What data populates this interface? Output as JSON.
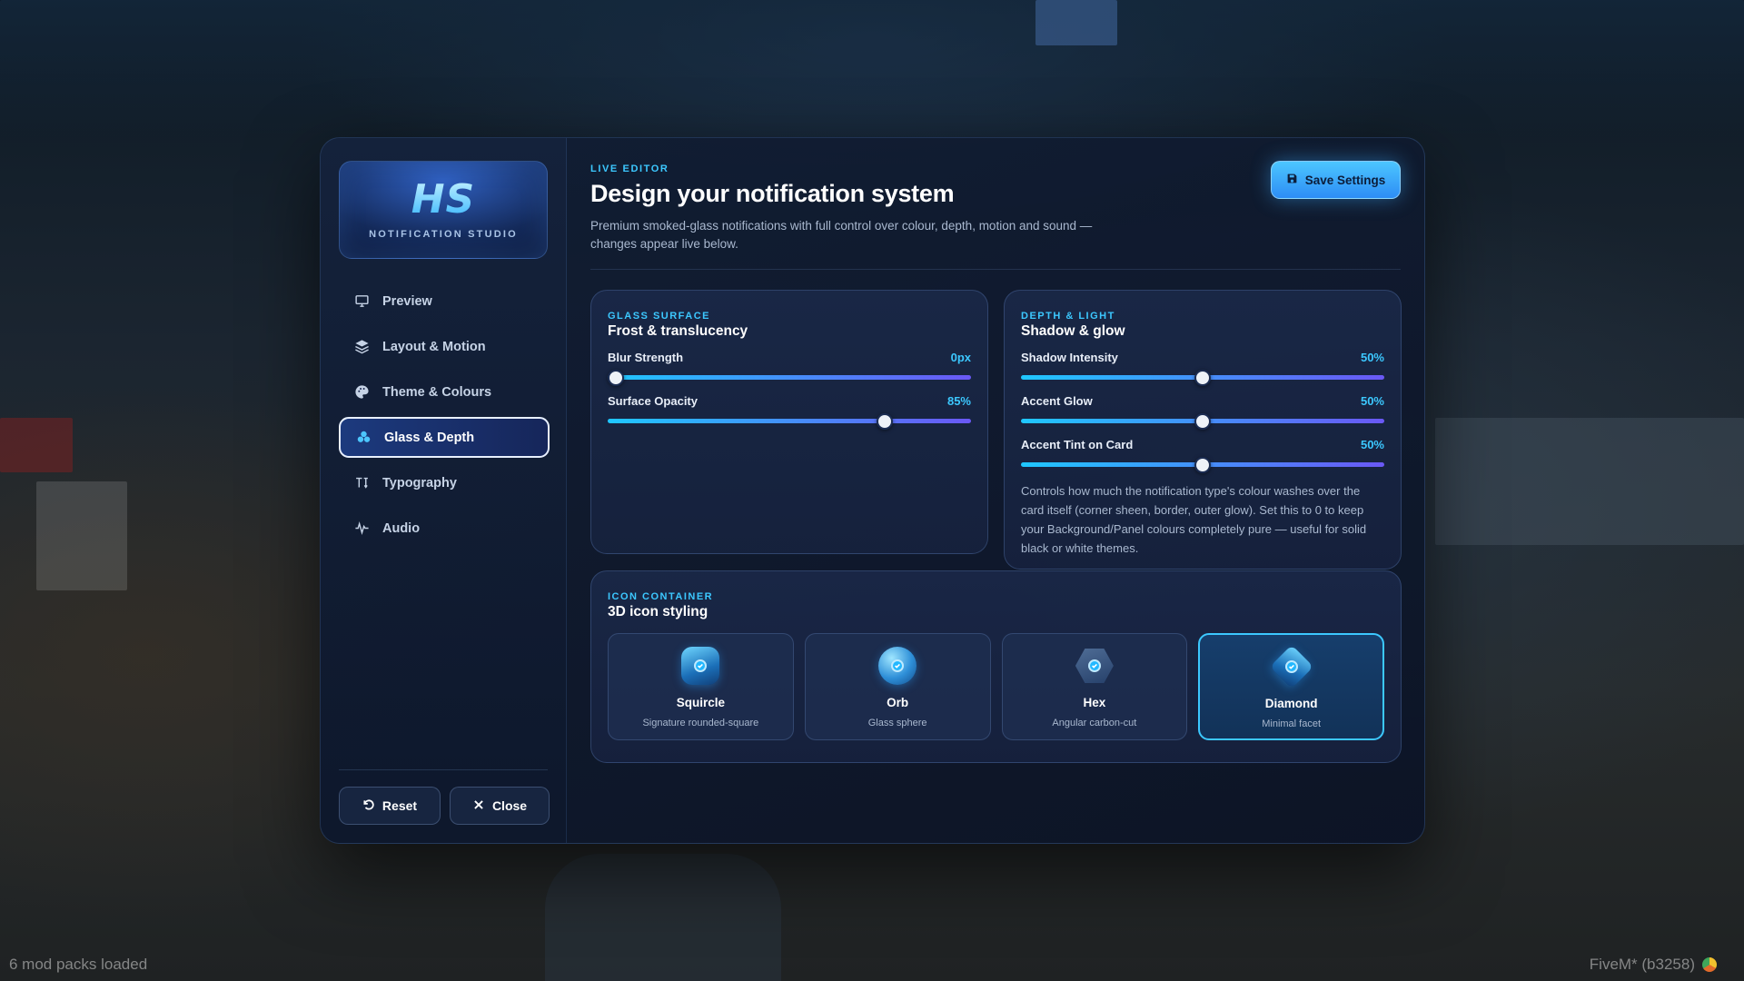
{
  "app": {
    "logo_mark": "HS",
    "logo_subtitle": "NOTIFICATION STUDIO"
  },
  "sidebar": {
    "items": [
      {
        "label": "Preview",
        "icon": "monitor-icon",
        "active": false
      },
      {
        "label": "Layout & Motion",
        "icon": "layers-icon",
        "active": false
      },
      {
        "label": "Theme & Colours",
        "icon": "palette-icon",
        "active": false
      },
      {
        "label": "Glass & Depth",
        "icon": "droplets-icon",
        "active": true
      },
      {
        "label": "Typography",
        "icon": "text-size-icon",
        "active": false
      },
      {
        "label": "Audio",
        "icon": "waveform-icon",
        "active": false
      }
    ],
    "reset_label": "Reset",
    "close_label": "Close"
  },
  "header": {
    "eyebrow": "LIVE EDITOR",
    "title": "Design your notification system",
    "description": "Premium smoked-glass notifications with full control over colour, depth, motion and sound — changes appear live below.",
    "save_label": "Save Settings"
  },
  "glass_surface": {
    "eyebrow": "GLASS SURFACE",
    "title": "Frost & translucency",
    "sliders": [
      {
        "label": "Blur Strength",
        "value_text": "0px",
        "fraction": 0.0
      },
      {
        "label": "Surface Opacity",
        "value_text": "85%",
        "fraction": 0.775
      }
    ]
  },
  "depth_light": {
    "eyebrow": "DEPTH & LIGHT",
    "title": "Shadow & glow",
    "sliders": [
      {
        "label": "Shadow Intensity",
        "value_text": "50%",
        "fraction": 0.5
      },
      {
        "label": "Accent Glow",
        "value_text": "50%",
        "fraction": 0.5
      },
      {
        "label": "Accent Tint on Card",
        "value_text": "50%",
        "fraction": 0.5
      }
    ],
    "help_text": "Controls how much the notification type's colour washes over the card itself (corner sheen, border, outer glow). Set this to 0 to keep your Background/Panel colours completely pure — useful for solid black or white themes."
  },
  "icon_container": {
    "eyebrow": "ICON CONTAINER",
    "title": "3D icon styling",
    "options": [
      {
        "name": "Squircle",
        "description": "Signature rounded-square",
        "selected": false
      },
      {
        "name": "Orb",
        "description": "Glass sphere",
        "selected": false
      },
      {
        "name": "Hex",
        "description": "Angular carbon-cut",
        "selected": false
      },
      {
        "name": "Diamond",
        "description": "Minimal facet",
        "selected": true
      }
    ]
  },
  "footer": {
    "left_status": "6 mod packs loaded",
    "right_status": "FiveM* (b3258)"
  },
  "colors": {
    "accent": "#3cc8ff",
    "slider_start": "#1fc7ff",
    "slider_end": "#6a58f5",
    "panel_bg": "#12203a"
  }
}
